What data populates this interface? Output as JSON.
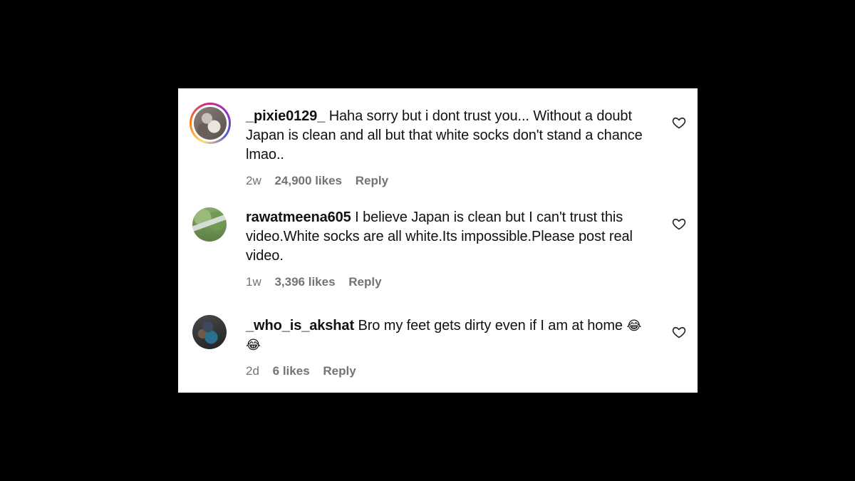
{
  "comments": [
    {
      "username": "_pixie0129_",
      "text": "Haha sorry but i dont trust you... Without a doubt Japan is clean and all but that white socks don't stand a chance lmao..",
      "line1": "Haha sorry but i dont trust you... Without a doubt",
      "line2": "Japan is clean and all but that white socks don't stand a chance",
      "line3": "lmao..",
      "time": "2w",
      "likes": "24,900 likes",
      "reply": "Reply"
    },
    {
      "username": "rawatmeena605",
      "text": "I believe Japan is clean but I can't trust this video.White socks are all white.Its impossible.Please post real video.",
      "line1": "I believe Japan is clean but I can't trust this",
      "line2": "video.White socks are all white.Its impossible.Please post real",
      "line3": "video.",
      "time": "1w",
      "likes": "3,396 likes",
      "reply": "Reply"
    },
    {
      "username": "_who_is_akshat",
      "text": "Bro my feet gets dirty even if I am at home 😂 😂",
      "line1": "Bro my feet gets dirty even if I am at home",
      "emoji": "😂",
      "time": "2d",
      "likes": "6 likes",
      "reply": "Reply"
    }
  ],
  "icons": {
    "like": "heart-outline-icon"
  }
}
